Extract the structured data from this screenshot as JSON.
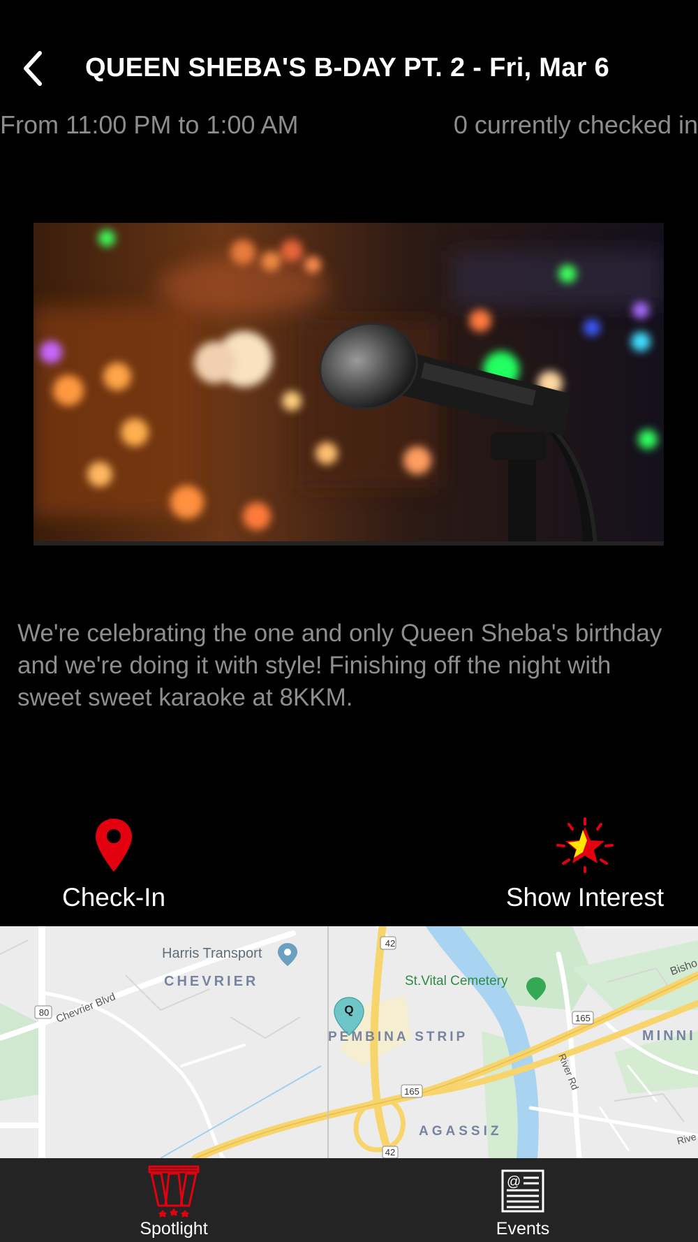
{
  "header": {
    "title": "QUEEN SHEBA'S B-DAY PT. 2 - Fri, Mar 6",
    "time_range": "From 11:00 PM to 1:00 AM",
    "checked_in": "0 currently checked in"
  },
  "event": {
    "description": "We're celebrating the one and only Queen Sheba's birthday and we're doing it with style! Finishing off the night with sweet sweet karaoke at 8KKM."
  },
  "actions": {
    "checkin_label": "Check-In",
    "interest_label": "Show Interest"
  },
  "map": {
    "labels": {
      "harris": "Harris Transport",
      "chevrier": "CHEVRIER",
      "chevrier_blvd": "Chevrier Blvd",
      "cemetery": "St.Vital Cemetery",
      "pembina": "PEMBINA STRIP",
      "agassiz": "AGASSIZ",
      "minn": "MINNI",
      "river_rd": "River Rd",
      "bisho": "Bisho",
      "river": "Rive",
      "route_42_top": "42",
      "route_42_bottom": "42",
      "route_80": "80",
      "route_165_left": "165",
      "route_165_right": "165",
      "pin_letter": "Q"
    }
  },
  "tabs": [
    {
      "label": "Spotlight"
    },
    {
      "label": "Events"
    }
  ],
  "colors": {
    "accent_red": "#e3000f",
    "background": "#000000",
    "tabbar": "#242424",
    "muted_text": "#8e8e8e"
  },
  "icons": {
    "back": "chevron-left-icon",
    "checkin": "map-pin-icon",
    "interest": "star-burst-icon",
    "spotlight": "spotlight-icon",
    "events": "newspaper-icon"
  }
}
